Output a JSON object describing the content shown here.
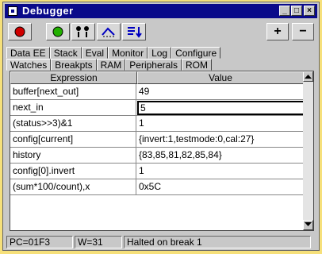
{
  "window": {
    "title": "Debugger",
    "minimize_symbol": "_",
    "maximize_symbol": "□",
    "close_symbol": "×"
  },
  "toolbar": {
    "buttons": [
      {
        "icon": "stop-record-icon",
        "color": "#d00000"
      },
      {
        "icon": "go-icon",
        "label": "go",
        "color": "#22b000"
      },
      {
        "icon": "step-icon"
      },
      {
        "icon": "step-over-icon"
      },
      {
        "icon": "step-out-icon"
      }
    ],
    "add_label": "+",
    "remove_label": "−"
  },
  "tabs": {
    "row1": [
      "Data EE",
      "Stack",
      "Eval",
      "Monitor",
      "Log",
      "Configure"
    ],
    "row2": [
      "Watches",
      "Breakpts",
      "RAM",
      "Peripherals",
      "ROM"
    ],
    "active": "Watches"
  },
  "watches": {
    "columns": [
      "Expression",
      "Value"
    ],
    "rows": [
      {
        "expression": "buffer[next_out]",
        "value": "49"
      },
      {
        "expression": "next_in",
        "value": "5",
        "editing": true
      },
      {
        "expression": "(status>>3)&1",
        "value": "1"
      },
      {
        "expression": "config[current]",
        "value": "{invert:1,testmode:0,cal:27}"
      },
      {
        "expression": "history",
        "value": "{83,85,81,82,85,84}"
      },
      {
        "expression": "config[0].invert",
        "value": "1"
      },
      {
        "expression": "(sum*100/count),x",
        "value": "0x5C"
      }
    ]
  },
  "status_bar": {
    "pc": "PC=01F3",
    "w": "W=31",
    "message": "Halted on break 1"
  }
}
